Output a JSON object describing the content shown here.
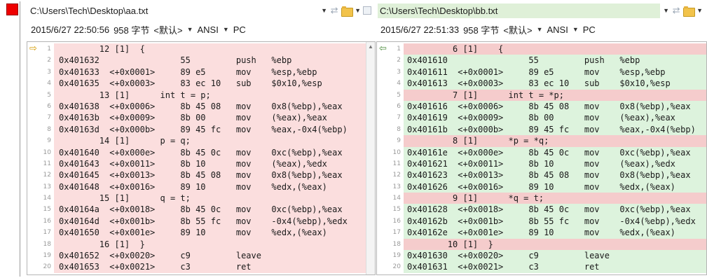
{
  "left": {
    "path": "C:\\Users\\Tech\\Desktop\\aa.txt",
    "info": {
      "datetime": "2015/6/27 22:50:56",
      "size": "958 字节",
      "format": "<默认>",
      "encoding": "ANSI",
      "lineend": "PC"
    },
    "lines": [
      {
        "n": "1",
        "text": "        12 [1]  {"
      },
      {
        "n": "2",
        "text": "0x401632                55         push   %ebp"
      },
      {
        "n": "3",
        "text": "0x401633  <+0x0001>     89 e5      mov    %esp,%ebp"
      },
      {
        "n": "4",
        "text": "0x401635  <+0x0003>     83 ec 10   sub    $0x10,%esp"
      },
      {
        "n": "5",
        "text": "        13 [1]      int t = p;"
      },
      {
        "n": "6",
        "text": "0x401638  <+0x0006>     8b 45 08   mov    0x8(%ebp),%eax"
      },
      {
        "n": "7",
        "text": "0x40163b  <+0x0009>     8b 00      mov    (%eax),%eax"
      },
      {
        "n": "8",
        "text": "0x40163d  <+0x000b>     89 45 fc   mov    %eax,-0x4(%ebp)"
      },
      {
        "n": "9",
        "text": "        14 [1]      p = q;"
      },
      {
        "n": "10",
        "text": "0x401640  <+0x000e>     8b 45 0c   mov    0xc(%ebp),%eax"
      },
      {
        "n": "11",
        "text": "0x401643  <+0x0011>     8b 10      mov    (%eax),%edx"
      },
      {
        "n": "12",
        "text": "0x401645  <+0x0013>     8b 45 08   mov    0x8(%ebp),%eax"
      },
      {
        "n": "13",
        "text": "0x401648  <+0x0016>     89 10      mov    %edx,(%eax)"
      },
      {
        "n": "14",
        "text": "        15 [1]      q = t;"
      },
      {
        "n": "15",
        "text": "0x40164a  <+0x0018>     8b 45 0c   mov    0xc(%ebp),%eax"
      },
      {
        "n": "16",
        "text": "0x40164d  <+0x001b>     8b 55 fc   mov    -0x4(%ebp),%edx"
      },
      {
        "n": "17",
        "text": "0x401650  <+0x001e>     89 10      mov    %edx,(%eax)"
      },
      {
        "n": "18",
        "text": "        16 [1]  }"
      },
      {
        "n": "19",
        "text": "0x401652  <+0x0020>     c9         leave"
      },
      {
        "n": "20",
        "text": "0x401653  <+0x0021>     c3         ret"
      }
    ]
  },
  "right": {
    "path": "C:\\Users\\Tech\\Desktop\\bb.txt",
    "info": {
      "datetime": "2015/6/27 22:51:33",
      "size": "958 字节",
      "format": "<默认>",
      "encoding": "ANSI",
      "lineend": "PC"
    },
    "lines": [
      {
        "n": "1",
        "text": "         6 [1]    {",
        "diff": true
      },
      {
        "n": "2",
        "text": "0x401610                55         push   %ebp"
      },
      {
        "n": "3",
        "text": "0x401611  <+0x0001>     89 e5      mov    %esp,%ebp"
      },
      {
        "n": "4",
        "text": "0x401613  <+0x0003>     83 ec 10   sub    $0x10,%esp"
      },
      {
        "n": "5",
        "text": "         7 [1]      int t = *p;",
        "diff": true
      },
      {
        "n": "6",
        "text": "0x401616  <+0x0006>     8b 45 08   mov    0x8(%ebp),%eax"
      },
      {
        "n": "7",
        "text": "0x401619  <+0x0009>     8b 00      mov    (%eax),%eax"
      },
      {
        "n": "8",
        "text": "0x40161b  <+0x000b>     89 45 fc   mov    %eax,-0x4(%ebp)"
      },
      {
        "n": "9",
        "text": "         8 [1]      *p = *q;",
        "diff": true
      },
      {
        "n": "10",
        "text": "0x40161e  <+0x000e>     8b 45 0c   mov    0xc(%ebp),%eax"
      },
      {
        "n": "11",
        "text": "0x401621  <+0x0011>     8b 10      mov    (%eax),%edx"
      },
      {
        "n": "12",
        "text": "0x401623  <+0x0013>     8b 45 08   mov    0x8(%ebp),%eax"
      },
      {
        "n": "13",
        "text": "0x401626  <+0x0016>     89 10      mov    %edx,(%eax)"
      },
      {
        "n": "14",
        "text": "         9 [1]      *q = t;",
        "diff": true
      },
      {
        "n": "15",
        "text": "0x401628  <+0x0018>     8b 45 0c   mov    0xc(%ebp),%eax"
      },
      {
        "n": "16",
        "text": "0x40162b  <+0x001b>     8b 55 fc   mov    -0x4(%ebp),%edx"
      },
      {
        "n": "17",
        "text": "0x40162e  <+0x001e>     89 10      mov    %edx,(%eax)"
      },
      {
        "n": "18",
        "text": "        10 [1]  }",
        "diff": true
      },
      {
        "n": "19",
        "text": "0x401630  <+0x0020>     c9         leave"
      },
      {
        "n": "20",
        "text": "0x401631  <+0x0021>     c3         ret"
      }
    ]
  },
  "colors": {
    "left_row": "#fbdede",
    "right_row": "#ddf3dd",
    "right_diff_row": "#f5cccc",
    "marker": "#ee0000",
    "right_path_bg": "#dff0d8"
  },
  "icons": {
    "marker": "red-square-icon",
    "current_line_left": "arrow-right-icon",
    "current_line_right": "arrow-left-icon",
    "swap": "swap-icon",
    "open": "folder-open-icon",
    "save": "save-icon",
    "dropdown": "chevron-down-icon",
    "scroll_up": "scroll-up-icon"
  }
}
